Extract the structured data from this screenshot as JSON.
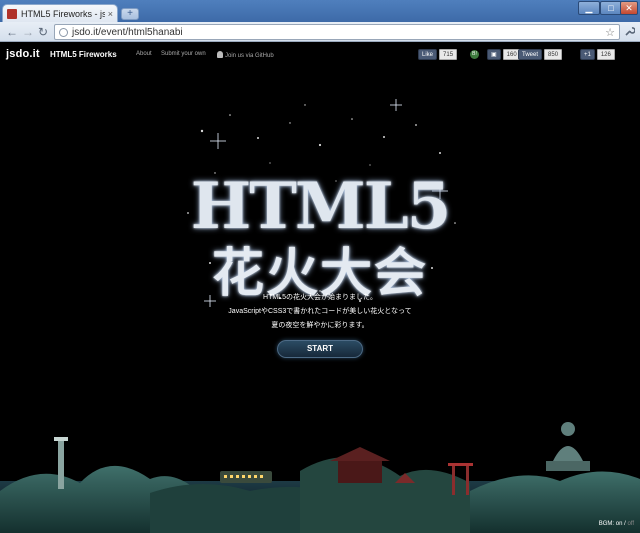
{
  "browser": {
    "tab_title": "HTML5 Fireworks - js",
    "tab_close": "×",
    "newtab": "+",
    "url": "jsdo.it/event/html5hanabi",
    "win_min": "▁",
    "win_max": "□",
    "win_close": "✕",
    "back": "←",
    "forward": "→",
    "reload": "↻",
    "star": "☆",
    "wrench": "🔧"
  },
  "site": {
    "logo": "jsdo.it",
    "title": "HTML5 Fireworks",
    "nav": {
      "about": "About",
      "submit": "Submit your own",
      "github": "Join us via GitHub"
    },
    "social": {
      "like_label": "Like",
      "like_count": "715",
      "hatena_label": "B!",
      "buzz_label": "▣",
      "buzz_count": "160",
      "tweet_label": "Tweet",
      "tweet_count": "850",
      "plus_label": "+1",
      "plus_count": "126"
    }
  },
  "hero": {
    "line1": "HTML5",
    "line2": "花火大会"
  },
  "intro": {
    "line1": "HTML5の花火大会が始まりました。",
    "line2": "JavaScriptやCSS3で書かれたコードが美しい花火となって",
    "line3": "夏の夜空を鮮やかに彩ります。"
  },
  "start_label": "START",
  "bgm": {
    "label": "BGM:",
    "on": "on",
    "sep": "/",
    "off": "off"
  },
  "colors": {
    "page_bg": "#000000",
    "chrome_frame": "#3d6aa8",
    "start_btn": "#1f3a52"
  }
}
